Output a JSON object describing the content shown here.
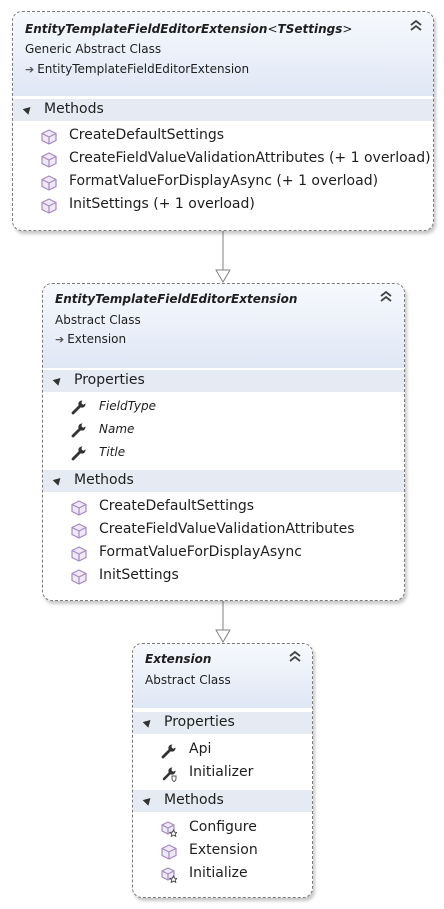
{
  "diagram": {
    "classes": [
      {
        "id": "generic",
        "name": "EntityTemplateFieldEditorExtension",
        "generic_open": "<",
        "generic_param": "TSettings",
        "generic_close": ">",
        "kind": "Generic Abstract Class",
        "base": "EntityTemplateFieldEditorExtension",
        "sections": [
          {
            "label": "Methods",
            "items": [
              {
                "text": "CreateDefaultSettings",
                "icon": "method-icon"
              },
              {
                "text": "CreateFieldValueValidationAttributes (+ 1 overload)",
                "icon": "method-icon"
              },
              {
                "text": "FormatValueForDisplayAsync (+ 1 overload)",
                "icon": "method-icon"
              },
              {
                "text": "InitSettings (+ 1 overload)",
                "icon": "method-icon"
              }
            ]
          }
        ]
      },
      {
        "id": "abstract",
        "name": "EntityTemplateFieldEditorExtension",
        "kind": "Abstract Class",
        "base": "Extension",
        "sections": [
          {
            "label": "Properties",
            "items": [
              {
                "text": "FieldType",
                "icon": "property-icon"
              },
              {
                "text": "Name",
                "icon": "property-icon"
              },
              {
                "text": "Title",
                "icon": "property-icon"
              }
            ]
          },
          {
            "label": "Methods",
            "items": [
              {
                "text": "CreateDefaultSettings",
                "icon": "method-icon"
              },
              {
                "text": "CreateFieldValueValidationAttributes",
                "icon": "method-icon"
              },
              {
                "text": "FormatValueForDisplayAsync",
                "icon": "method-icon"
              },
              {
                "text": "InitSettings",
                "icon": "method-icon"
              }
            ]
          }
        ]
      },
      {
        "id": "extension",
        "name": "Extension",
        "kind": "Abstract Class",
        "sections": [
          {
            "label": "Properties",
            "items": [
              {
                "text": "Api",
                "icon": "property-icon"
              },
              {
                "text": "Initializer",
                "icon": "protected-property-icon"
              }
            ]
          },
          {
            "label": "Methods",
            "items": [
              {
                "text": "Configure",
                "icon": "protected-method-icon"
              },
              {
                "text": "Extension",
                "icon": "method-icon"
              },
              {
                "text": "Initialize",
                "icon": "protected-method-icon"
              }
            ]
          }
        ]
      }
    ],
    "colors": {
      "header_gradient_top": "#f7f9fd",
      "header_gradient_bottom": "#dfe7f5",
      "section_band": "#e6ebf3",
      "method_icon": "#a58bc0",
      "property_icon": "#333333",
      "connector": "#808080"
    }
  }
}
